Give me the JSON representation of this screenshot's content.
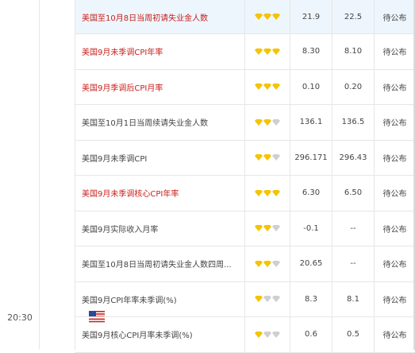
{
  "time": "20:30",
  "country_flag": "us-flag",
  "colors": {
    "highlight_red": "#c8201c",
    "gold": "#f5c400",
    "silver": "#cfcfcf",
    "row_highlight": "#eef6fd"
  },
  "rows": [
    {
      "name": "美国至10月8日当周初请失业金人数",
      "color": "red",
      "stars": 3,
      "previous": "21.9",
      "forecast": "22.5",
      "actual": "待公布"
    },
    {
      "name": "美国9月未季调CPI年率",
      "color": "red",
      "stars": 3,
      "previous": "8.30",
      "forecast": "8.10",
      "actual": "待公布"
    },
    {
      "name": "美国9月季调后CPI月率",
      "color": "red",
      "stars": 3,
      "previous": "0.10",
      "forecast": "0.20",
      "actual": "待公布"
    },
    {
      "name": "美国至10月1日当周续请失业金人数",
      "color": "gray",
      "stars": 2,
      "previous": "136.1",
      "forecast": "136.5",
      "actual": "待公布"
    },
    {
      "name": "美国9月未季调CPI",
      "color": "gray",
      "stars": 2,
      "previous": "296.171",
      "forecast": "296.43",
      "actual": "待公布"
    },
    {
      "name": "美国9月未季调核心CPI年率",
      "color": "red",
      "stars": 3,
      "previous": "6.30",
      "forecast": "6.50",
      "actual": "待公布"
    },
    {
      "name": "美国9月实际收入月率",
      "color": "gray",
      "stars": 2,
      "previous": "-0.1",
      "forecast": "--",
      "actual": "待公布"
    },
    {
      "name": "美国至10月8日当周初请失业金人数四周...",
      "color": "gray",
      "stars": 2,
      "previous": "20.65",
      "forecast": "--",
      "actual": "待公布"
    },
    {
      "name": "美国9月CPI年率未季调(%)",
      "color": "gray",
      "stars": 1,
      "previous": "8.3",
      "forecast": "8.1",
      "actual": "待公布"
    },
    {
      "name": "美国9月核心CPI月率未季调(%)",
      "color": "gray",
      "stars": 1,
      "previous": "0.6",
      "forecast": "0.5",
      "actual": "待公布"
    }
  ]
}
